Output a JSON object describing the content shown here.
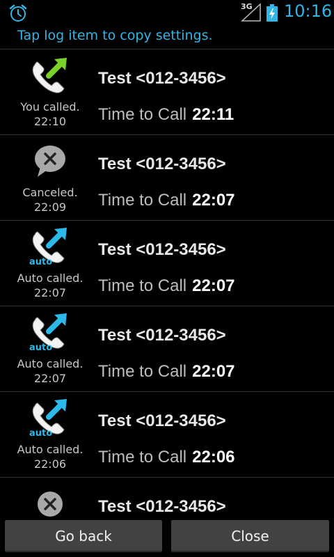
{
  "status_bar": {
    "time": "10:16",
    "network": "3G",
    "colors": {
      "accent": "#33b5e5"
    }
  },
  "header": {
    "hint": "Tap log item to copy settings."
  },
  "log": [
    {
      "type": "you-called",
      "icon": "phone-outgoing-green-icon",
      "status": "You called.",
      "time": "22:10",
      "name": "Test <012-3456>",
      "ttc_label": "Time to Call",
      "ttc_time": "22:11"
    },
    {
      "type": "canceled",
      "icon": "cancel-bubble-icon",
      "status": "Canceled.",
      "time": "22:09",
      "name": "Test <012-3456>",
      "ttc_label": "Time to Call",
      "ttc_time": "22:07"
    },
    {
      "type": "auto-called",
      "icon": "phone-auto-blue-icon",
      "badge": "auto",
      "status": "Auto called.",
      "time": "22:07",
      "name": "Test <012-3456>",
      "ttc_label": "Time to Call",
      "ttc_time": "22:07"
    },
    {
      "type": "auto-called",
      "icon": "phone-auto-blue-icon",
      "badge": "auto",
      "status": "Auto called.",
      "time": "22:07",
      "name": "Test <012-3456>",
      "ttc_label": "Time to Call",
      "ttc_time": "22:07"
    },
    {
      "type": "auto-called",
      "icon": "phone-auto-blue-icon",
      "badge": "auto",
      "status": "Auto called.",
      "time": "22:06",
      "name": "Test <012-3456>",
      "ttc_label": "Time to Call",
      "ttc_time": "22:06"
    },
    {
      "type": "canceled",
      "icon": "cancel-bubble-icon",
      "status": "",
      "time": "",
      "name": "Test <012-3456>",
      "ttc_label": "",
      "ttc_time": ""
    }
  ],
  "buttons": {
    "back": "Go back",
    "close": "Close"
  }
}
